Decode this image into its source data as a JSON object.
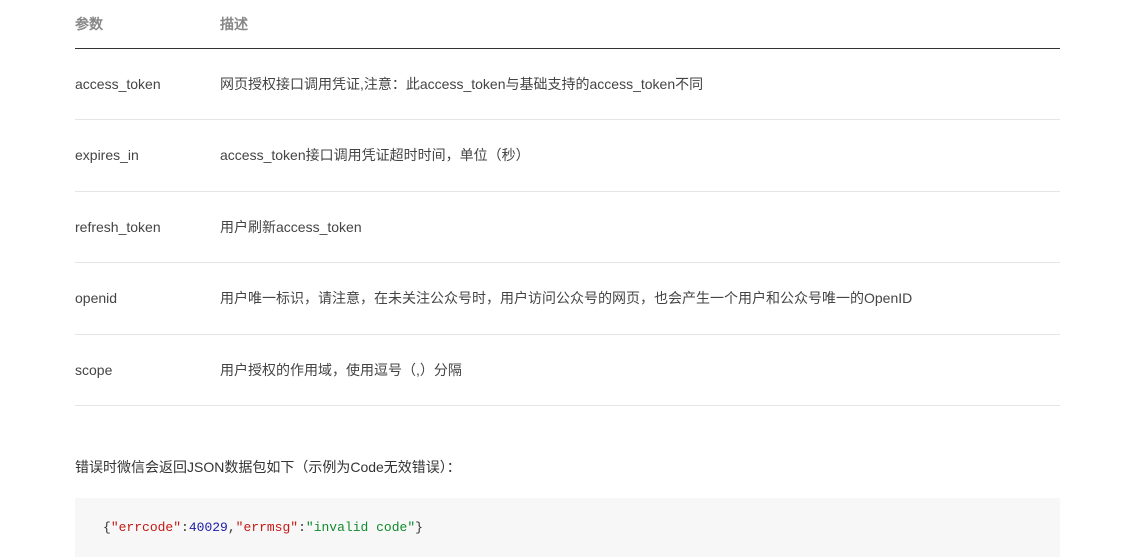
{
  "table": {
    "headers": {
      "param": "参数",
      "desc": "描述"
    },
    "rows": [
      {
        "param": "access_token",
        "desc": "网页授权接口调用凭证,注意：此access_token与基础支持的access_token不同"
      },
      {
        "param": "expires_in",
        "desc": "access_token接口调用凭证超时时间，单位（秒）"
      },
      {
        "param": "refresh_token",
        "desc": "用户刷新access_token"
      },
      {
        "param": "openid",
        "desc": "用户唯一标识，请注意，在未关注公众号时，用户访问公众号的网页，也会产生一个用户和公众号唯一的OpenID"
      },
      {
        "param": "scope",
        "desc": "用户授权的作用域，使用逗号（,）分隔"
      }
    ]
  },
  "error_note": "错误时微信会返回JSON数据包如下（示例为Code无效错误）：",
  "code": {
    "brace_open": "{",
    "k1": "\"errcode\"",
    "colon1": ":",
    "v1": "40029",
    "comma": ",",
    "k2": "\"errmsg\"",
    "colon2": ":",
    "v2": "\"invalid code\"",
    "brace_close": "}"
  }
}
